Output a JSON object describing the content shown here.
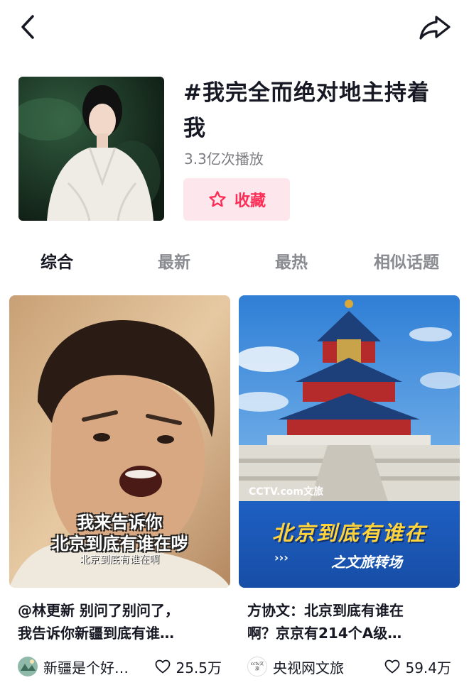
{
  "topbar": {
    "back_icon": "chevron-left-icon",
    "share_icon": "share-arrow-icon"
  },
  "topic": {
    "title_line1": "#我完全而绝对地主持着",
    "title_line2": "我",
    "play_count": "3.3亿次播放",
    "favorite_label": "收藏",
    "favorite_icon": "star-icon",
    "accent_color": "#fe2c55"
  },
  "tabs": [
    {
      "label": "综合",
      "active": true
    },
    {
      "label": "最新",
      "active": false
    },
    {
      "label": "最热",
      "active": false
    },
    {
      "label": "相似话题",
      "active": false
    }
  ],
  "videos": [
    {
      "overlay_line1": "我来告诉你",
      "overlay_line2": "北京到底有谁在哕",
      "overlay_line3": "北京到底有谁在啊",
      "desc_line1": "@林更新 别问了别问了，",
      "desc_line2": "我告诉你新疆到底有谁…",
      "author": "新疆是个好…",
      "likes": "25.5万"
    },
    {
      "overlay_logo": "CCTV.com文旅",
      "overlay_title": "北京到底有谁在",
      "overlay_subtitle": "之文旅转场",
      "desc_line1": "方协文：北京到底有谁在",
      "desc_line2": "啊？京京有214个A级…",
      "author": "央视网文旅",
      "author_badge": "cctv文旅",
      "likes": "59.4万"
    }
  ]
}
